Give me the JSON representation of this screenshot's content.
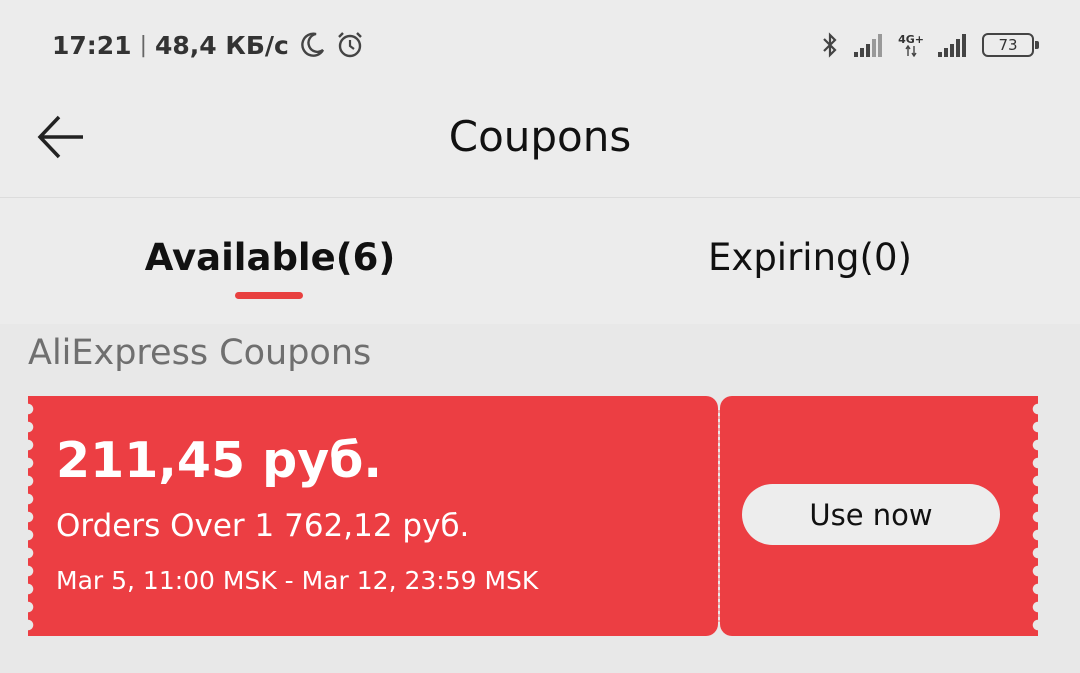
{
  "status_bar": {
    "time": "17:21",
    "separator": "|",
    "speed": "48,4 КБ/с",
    "network_type": "4G+",
    "battery": "73"
  },
  "header": {
    "title": "Coupons"
  },
  "tabs": [
    {
      "label": "Available(6)",
      "active": true
    },
    {
      "label": "Expiring(0)",
      "active": false
    }
  ],
  "section": {
    "title": "AliExpress Coupons"
  },
  "coupons": [
    {
      "amount": "211,45 руб.",
      "condition": "Orders Over 1 762,12 руб.",
      "validity": "Mar 5, 11:00 MSK - Mar 12, 23:59 MSK",
      "action_label": "Use now"
    }
  ],
  "colors": {
    "accent": "#ec3e43",
    "tab_indicator": "#e8403f",
    "background": "#e8e8e8"
  }
}
